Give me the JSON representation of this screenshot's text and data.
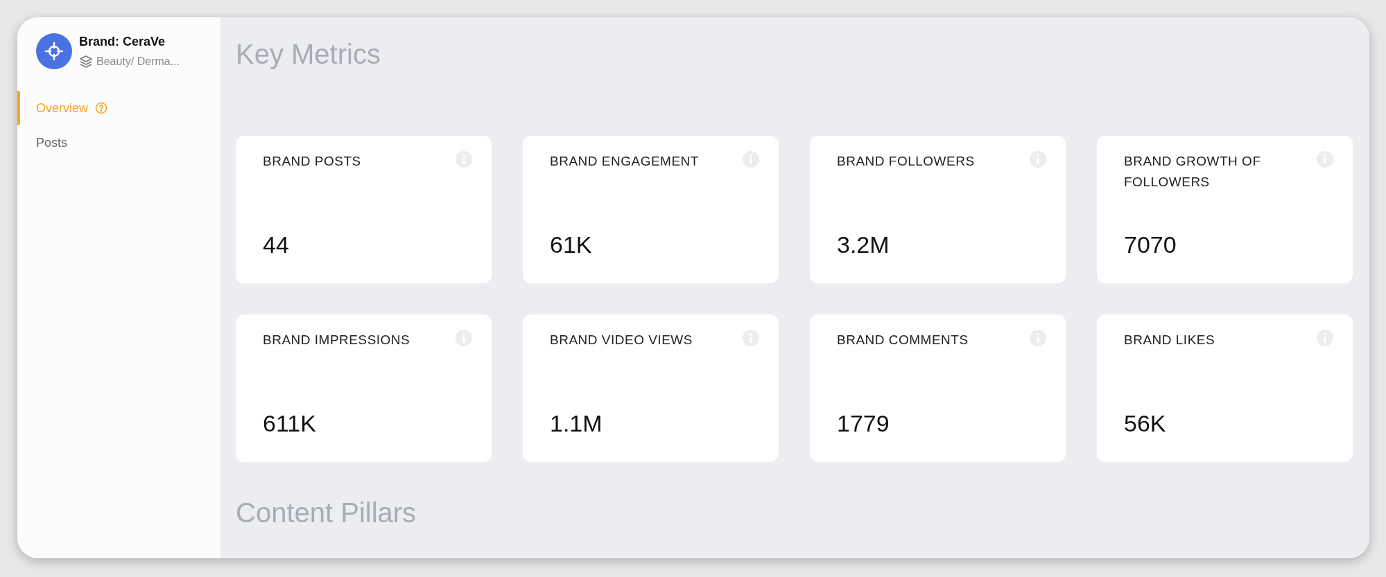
{
  "brand": {
    "name": "Brand: CeraVe",
    "category": "Beauty/ Derma..."
  },
  "nav": [
    {
      "label": "Overview",
      "selected": true,
      "help": true
    },
    {
      "label": "Posts",
      "selected": false,
      "help": false
    }
  ],
  "sections": [
    {
      "title": "Key Metrics",
      "metrics": [
        {
          "label": "BRAND POSTS",
          "value": "44"
        },
        {
          "label": "BRAND ENGAGEMENT",
          "value": "61K"
        },
        {
          "label": "BRAND FOLLOWERS",
          "value": "3.2M"
        },
        {
          "label": "BRAND GROWTH OF FOLLOWERS",
          "value": "7070"
        },
        {
          "label": "BRAND IMPRESSIONS",
          "value": "611K"
        },
        {
          "label": "BRAND VIDEO VIEWS",
          "value": "1.1M"
        },
        {
          "label": "BRAND COMMENTS",
          "value": "1779"
        },
        {
          "label": "BRAND LIKES",
          "value": "56K"
        }
      ]
    },
    {
      "title": "Content Pillars"
    }
  ]
}
